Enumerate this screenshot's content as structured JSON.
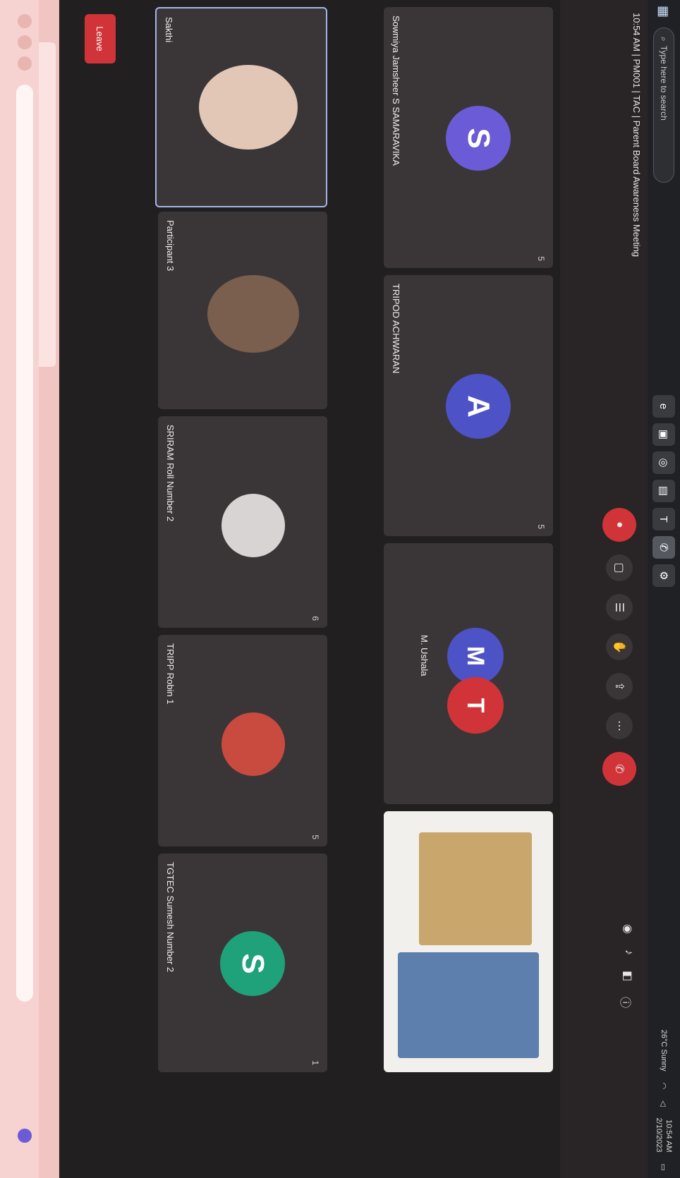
{
  "taskbar": {
    "search_placeholder": "Type here to search",
    "clock_time": "10:54 AM",
    "clock_date": "2/10/2023",
    "weather": "26°C Sunny",
    "apps": [
      "edge-icon",
      "file-explorer-icon",
      "chrome-icon",
      "app-icon",
      "teams-icon",
      "phone-icon",
      "settings-icon"
    ]
  },
  "meeting": {
    "title": "10:54 AM | PM001 | TAC | Parent Board Awareness Meeting",
    "leave_label": "Leave"
  },
  "tiles": [
    {
      "name": "Sakthi",
      "number": "",
      "avatar_letter": "",
      "avatar_color": ""
    },
    {
      "name": "Participant 3",
      "number": "",
      "avatar_letter": "",
      "avatar_color": ""
    },
    {
      "name": "SRIRAM Roll Number 2",
      "number": "6",
      "avatar_letter": "",
      "avatar_color": ""
    },
    {
      "name": "TRIPP Robin 1",
      "number": "5",
      "avatar_letter": "",
      "avatar_color": ""
    },
    {
      "name": "TGTEC Sumesh Number 2",
      "number": "1",
      "avatar_letter": "S",
      "avatar_color": "#1fa17a"
    },
    {
      "name": "Sowmiya Jamsheer S SAMARAVIKA",
      "number": "5",
      "avatar_letter": "S",
      "avatar_color": "#6b5bd6"
    },
    {
      "name": "TRIPOD ACHWARAN",
      "number": "5",
      "avatar_letter": "A",
      "avatar_color": "#4d52c7"
    },
    {
      "name": "M. Ushala",
      "number": "",
      "avatar_letter": "M",
      "avatar_color": "#4d52c7"
    }
  ]
}
